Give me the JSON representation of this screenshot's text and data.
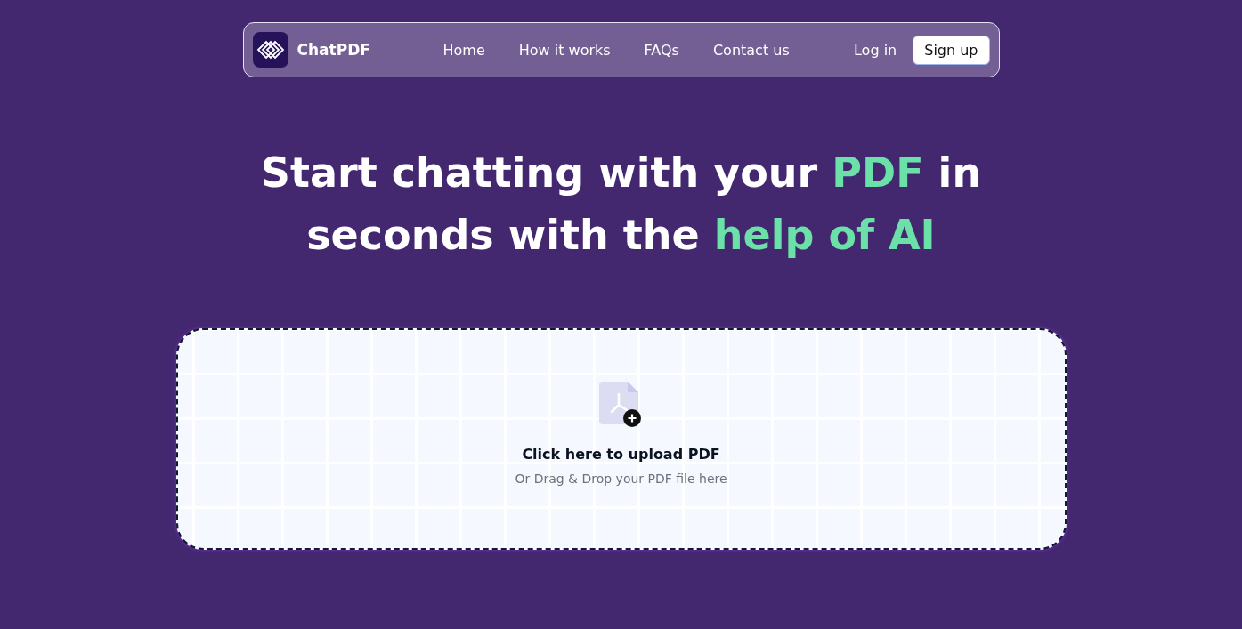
{
  "nav": {
    "brand": "ChatPDF",
    "links": [
      "Home",
      "How it works",
      "FAQs",
      "Contact us"
    ],
    "login": "Log in",
    "signup": "Sign up"
  },
  "headline": {
    "lines": [
      [
        {
          "text": "Start chatting with your ",
          "highlight": false
        },
        {
          "text": "PDF",
          "highlight": true
        },
        {
          "text": " in",
          "highlight": false
        }
      ],
      [
        {
          "text": "seconds with the ",
          "highlight": false
        },
        {
          "text": "help of AI",
          "highlight": true
        }
      ]
    ]
  },
  "upload": {
    "title": "Click here to upload PDF",
    "subtitle": "Or Drag & Drop your PDF file here"
  }
}
